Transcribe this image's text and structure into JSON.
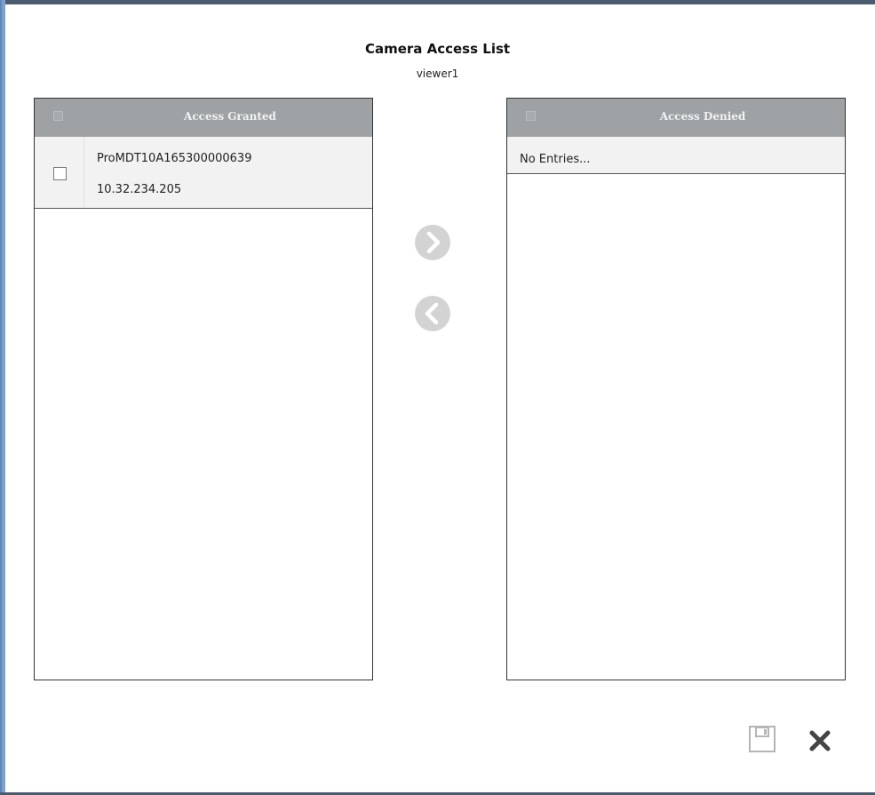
{
  "dialog": {
    "title": "Camera Access List",
    "user": "viewer1"
  },
  "granted": {
    "header": "Access Granted",
    "items": [
      {
        "name": "ProMDT10A165300000639",
        "ip": "10.32.234.205"
      }
    ]
  },
  "denied": {
    "header": "Access Denied",
    "empty_text": "No Entries..."
  },
  "icons": {
    "move_right": "chevron-right-circle-icon",
    "move_left": "chevron-left-circle-icon",
    "save": "floppy-save-icon",
    "close": "close-x-icon"
  },
  "colors": {
    "header_bg": "#9fa2a4",
    "row_bg": "#f2f2f2",
    "button_gray": "#d3d3d3",
    "frame_blue": "#5f86b4"
  }
}
